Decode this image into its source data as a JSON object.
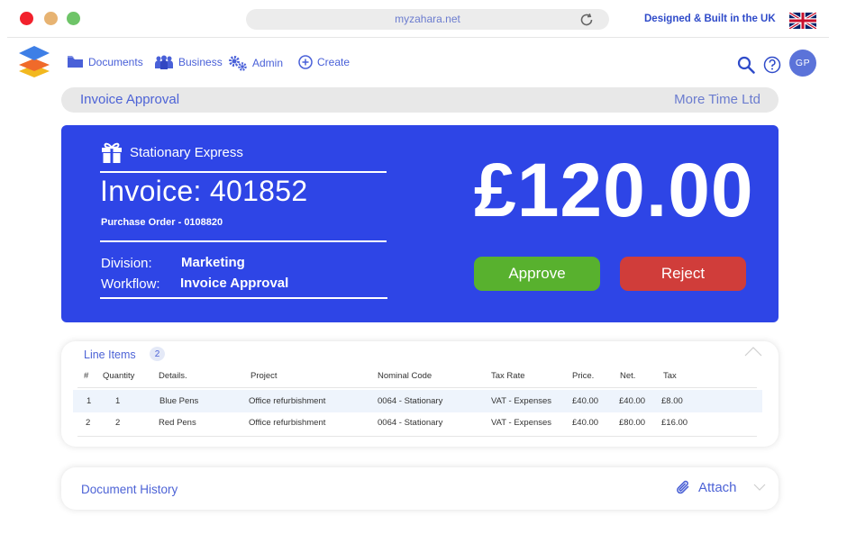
{
  "browser": {
    "url": "myzahara.net",
    "tagline": "Designed & Built in the UK",
    "controls": {
      "close_color": "#f2212c",
      "minimize_color": "#e7b372",
      "maximize_color": "#6ec468"
    }
  },
  "nav": {
    "items": [
      {
        "label": "Documents",
        "icon": "folder-icon"
      },
      {
        "label": "Business",
        "icon": "people-icon"
      },
      {
        "label": "Admin",
        "icon": "gears-icon"
      },
      {
        "label": "Create",
        "icon": "plus-circle-icon"
      }
    ],
    "avatar_initials": "GP"
  },
  "title_bar": {
    "left": "Invoice Approval",
    "right": "More Time Ltd"
  },
  "invoice": {
    "supplier": "Stationary Express",
    "title": "Invoice: 401852",
    "purchase_order": "Purchase Order - 0108820",
    "division_label": "Division:",
    "division_value": "Marketing",
    "workflow_label": "Workflow:",
    "workflow_value": "Invoice Approval",
    "amount": "£120.00",
    "approve_label": "Approve",
    "reject_label": "Reject",
    "colors": {
      "card": "#2e45e6",
      "approve": "#58b12e",
      "reject": "#d03d3a"
    }
  },
  "line_items": {
    "title": "Line Items",
    "count": "2",
    "columns": [
      "#",
      "Quantity",
      "Details.",
      "Project",
      "Nominal Code",
      "Tax Rate",
      "Price.",
      "Net.",
      "Tax"
    ],
    "rows": [
      [
        "1",
        "1",
        "Blue Pens",
        "Office refurbishment",
        "0064 - Stationary",
        "VAT - Expenses",
        "£40.00",
        "£40.00",
        "£8.00"
      ],
      [
        "2",
        "2",
        "Red Pens",
        "Office refurbishment",
        "0064 - Stationary",
        "VAT - Expenses",
        "£40.00",
        "£80.00",
        "£16.00"
      ]
    ]
  },
  "document_history": {
    "title": "Document History",
    "attach_label": "Attach"
  }
}
